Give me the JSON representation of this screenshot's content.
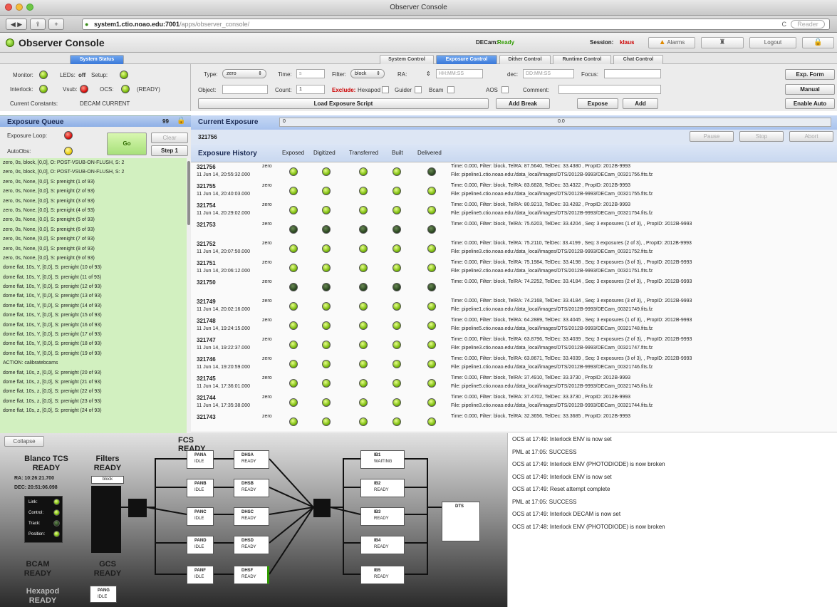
{
  "window": {
    "title": "Observer Console"
  },
  "browser": {
    "url_host": "system1.ctio.noao.edu:7001",
    "url_path": "/apps/observer_console/",
    "reader": "Reader"
  },
  "header": {
    "app_title": "Observer Console",
    "decam_label": "DECam:",
    "decam_status": "Ready",
    "session_label": "Session:",
    "session_user": "klaus",
    "alarms": "Alarms",
    "logout": "Logout"
  },
  "tabs": {
    "system_status": "System Status",
    "items": [
      "System Control",
      "Exposure Control",
      "Dither Control",
      "Runtime Control",
      "Chat Control"
    ]
  },
  "status": {
    "monitor": "Monitor:",
    "leds": "LEDs:",
    "leds_state": "off",
    "setup": "Setup:",
    "interlock": "Interlock:",
    "vsub": "Vsub:",
    "ocs": "OCS:",
    "ocs_state": "(READY)",
    "constants_label": "Current Constants:",
    "constants_value": "DECAM CURRENT"
  },
  "exposure_form": {
    "type_label": "Type:",
    "type_value": "zero",
    "time_label": "Time:",
    "time_ph": "s",
    "filter_label": "Filter:",
    "filter_value": "block",
    "ra_label": "RA:",
    "ra_ph": "HH:MM:SS",
    "dec_label": "dec:",
    "dec_ph": "DD:MM:SS",
    "focus_label": "Focus:",
    "object_label": "Object:",
    "count_label": "Count:",
    "count_value": "1",
    "exclude_label": "Exclude:",
    "hexapod": "Hexapod",
    "guider": "Guider",
    "bcam": "Bcam",
    "aos": "AOS",
    "comment_label": "Comment:",
    "load_script": "Load Exposure Script",
    "add_break": "Add Break",
    "expose": "Expose",
    "add": "Add",
    "exp_form": "Exp. Form",
    "manual": "Manual",
    "enable_auto": "Enable Auto"
  },
  "queue": {
    "title": "Exposure Queue",
    "count": "99",
    "loop_label": "Exposure Loop:",
    "autoobs_label": "AutoObs:",
    "go": "Go",
    "clear": "Clear",
    "step": "Step 1",
    "items": [
      "zero, 0s, block, [0,0], O: POST-VSUB-ON-FLUSH, S: 2",
      "zero, 0s, block, [0,0], O: POST-VSUB-ON-FLUSH, S: 2",
      "zero, 0s, None, [0,0], S: prenight (1 of 93)",
      "zero, 0s, None, [0,0], S: prenight (2 of 93)",
      "zero, 0s, None, [0,0], S: prenight (3 of 93)",
      "zero, 0s, None, [0,0], S: prenight (4 of 93)",
      "zero, 0s, None, [0,0], S: prenight (5 of 93)",
      "zero, 0s, None, [0,0], S: prenight (6 of 93)",
      "zero, 0s, None, [0,0], S: prenight (7 of 93)",
      "zero, 0s, None, [0,0], S: prenight (8 of 93)",
      "zero, 0s, None, [0,0], S: prenight (9 of 93)",
      "dome flat, 10s, Y, [0,0], S: prenight (10 of 93)",
      "dome flat, 10s, Y, [0,0], S: prenight (11 of 93)",
      "dome flat, 10s, Y, [0,0], S: prenight (12 of 93)",
      "dome flat, 10s, Y, [0,0], S: prenight (13 of 93)",
      "dome flat, 10s, Y, [0,0], S: prenight (14 of 93)",
      "dome flat, 10s, Y, [0,0], S: prenight (15 of 93)",
      "dome flat, 10s, Y, [0,0], S: prenight (16 of 93)",
      "dome flat, 10s, Y, [0,0], S: prenight (17 of 93)",
      "dome flat, 10s, Y, [0,0], S: prenight (18 of 93)",
      "dome flat, 10s, Y, [0,0], S: prenight (19 of 93)",
      "ACTION: calibratebcams",
      "dome flat, 10s, z, [0,0], S: prenight (20 of 93)",
      "dome flat, 10s, z, [0,0], S: prenight (21 of 93)",
      "dome flat, 10s, z, [0,0], S: prenight (22 of 93)",
      "dome flat, 10s, z, [0,0], S: prenight (23 of 93)",
      "dome flat, 10s, z, [0,0], S: prenight (24 of 93)"
    ]
  },
  "current": {
    "title": "Current Exposure",
    "id": "321756",
    "progress_start": "0",
    "progress_value": "0.0",
    "pause": "Pause",
    "stop": "Stop",
    "abort": "Abort"
  },
  "history": {
    "title": "Exposure History",
    "cols": [
      "Exposed",
      "Digitized",
      "Transferred",
      "Built",
      "Delivered"
    ],
    "rows": [
      {
        "id": "321756",
        "date": "11 Jun 14, 20:55:32.000",
        "type": "zero",
        "leds": "ggggd",
        "l1": "Time: 0.000, Filter: block, TelRA: 87.5640, TelDec: 33.4380 , PropID: 2012B-9993",
        "l2": "File: pipeline1.ctio.noao.edu:/data_local/images/DTS/2012B-9993/DECam_00321756.fits.fz"
      },
      {
        "id": "321755",
        "date": "11 Jun 14, 20:40:03.000",
        "type": "zero",
        "leds": "ggggg",
        "l1": "Time: 0.000, Filter: block, TelRA: 83.6828, TelDec: 33.4322 , PropID: 2012B-9993",
        "l2": "File: pipeline4.ctio.noao.edu:/data_local/images/DTS/2012B-9993/DECam_00321755.fits.fz"
      },
      {
        "id": "321754",
        "date": "11 Jun 14, 20:29:02.000",
        "type": "zero",
        "leds": "ggggg",
        "l1": "Time: 0.000, Filter: block, TelRA: 80.9213, TelDec: 33.4282 , PropID: 2012B-9993",
        "l2": "File: pipeline5.ctio.noao.edu:/data_local/images/DTS/2012B-9993/DECam_00321754.fits.fz"
      },
      {
        "id": "321753",
        "date": "",
        "type": "zero",
        "leds": "ddddd",
        "l1": "Time: 0.000, Filter: block, TelRA: 75.6203, TelDec: 33.4204 , Seq: 3 exposures (1 of 3), , PropID: 2012B-9993",
        "l2": ""
      },
      {
        "id": "321752",
        "date": "11 Jun 14, 20:07:50.000",
        "type": "zero",
        "leds": "ggggg",
        "l1": "Time: 0.000, Filter: block, TelRA: 75.2110, TelDec: 33.4199 , Seq: 3 exposures (2 of 3), , PropID: 2012B-9993",
        "l2": "File: pipeline3.ctio.noao.edu:/data_local/images/DTS/2012B-9993/DECam_00321752.fits.fz"
      },
      {
        "id": "321751",
        "date": "11 Jun 14, 20:06:12.000",
        "type": "zero",
        "leds": "ggggg",
        "l1": "Time: 0.000, Filter: block, TelRA: 75.1984, TelDec: 33.4198 , Seq: 3 exposures (3 of 3), , PropID: 2012B-9993",
        "l2": "File: pipeline2.ctio.noao.edu:/data_local/images/DTS/2012B-9993/DECam_00321751.fits.fz"
      },
      {
        "id": "321750",
        "date": "",
        "type": "zero",
        "leds": "ddddd",
        "l1": "Time: 0.000, Filter: block, TelRA: 74.2252, TelDec: 33.4184 , Seq: 3 exposures (2 of 3), , PropID: 2012B-9993",
        "l2": ""
      },
      {
        "id": "321749",
        "date": "11 Jun 14, 20:02:16.000",
        "type": "zero",
        "leds": "ggggg",
        "l1": "Time: 0.000, Filter: block, TelRA: 74.2168, TelDec: 33.4184 , Seq: 3 exposures (3 of 3), , PropID: 2012B-9993",
        "l2": "File: pipeline1.ctio.noao.edu:/data_local/images/DTS/2012B-9993/DECam_00321749.fits.fz"
      },
      {
        "id": "321748",
        "date": "11 Jun 14, 19:24:15.000",
        "type": "zero",
        "leds": "ggggg",
        "l1": "Time: 0.000, Filter: block, TelRA: 64.2889, TelDec: 33.4045 , Seq: 3 exposures (1 of 3), , PropID: 2012B-9993",
        "l2": "File: pipeline5.ctio.noao.edu:/data_local/images/DTS/2012B-9993/DECam_00321748.fits.fz"
      },
      {
        "id": "321747",
        "date": "11 Jun 14, 19:22:37.000",
        "type": "zero",
        "leds": "ggggg",
        "l1": "Time: 0.000, Filter: block, TelRA: 63.8796, TelDec: 33.4039 , Seq: 3 exposures (2 of 3), , PropID: 2012B-9993",
        "l2": "File: pipeline3.ctio.noao.edu:/data_local/images/DTS/2012B-9993/DECam_00321747.fits.fz"
      },
      {
        "id": "321746",
        "date": "11 Jun 14, 19:20:59.000",
        "type": "zero",
        "leds": "ggggg",
        "l1": "Time: 0.000, Filter: block, TelRA: 63.8671, TelDec: 33.4039 , Seq: 3 exposures (3 of 3), , PropID: 2012B-9993",
        "l2": "File: pipeline1.ctio.noao.edu:/data_local/images/DTS/2012B-9993/DECam_00321746.fits.fz"
      },
      {
        "id": "321745",
        "date": "11 Jun 14, 17:36:01.000",
        "type": "zero",
        "leds": "ggggg",
        "l1": "Time: 0.000, Filter: block, TelRA: 37.4910, TelDec: 33.3730 , PropID: 2012B-9993",
        "l2": "File: pipeline5.ctio.noao.edu:/data_local/images/DTS/2012B-9993/DECam_00321745.fits.fz"
      },
      {
        "id": "321744",
        "date": "11 Jun 14, 17:35:38.000",
        "type": "zero",
        "leds": "ggggg",
        "l1": "Time: 0.000, Filter: block, TelRA: 37.4702, TelDec: 33.3730 , PropID: 2012B-9993",
        "l2": "File: pipeline3.ctio.noao.edu:/data_local/images/DTS/2012B-9993/DECam_00321744.fits.fz"
      },
      {
        "id": "321743",
        "date": "",
        "type": "zero",
        "leds": "ggggg",
        "l1": "Time: 0.000, Filter: block, TelRA: 32.3656, TelDec: 33.3685 , PropID: 2012B-9993",
        "l2": ""
      }
    ]
  },
  "diagram": {
    "collapse": "Collapse",
    "blanco": "Blanco TCS",
    "blanco_state": "READY",
    "ra": "RA: 10:26:21.700",
    "dec": "DEC: 20:51:06.098",
    "filters": "Filters",
    "filters_state": "READY",
    "filter_value": "block",
    "fcs": "FCS",
    "fcs_state": "READY",
    "link": "Link:",
    "control": "Control:",
    "track": "Track:",
    "position": "Position:",
    "bcam": "BCAM",
    "bcam_state": "READY",
    "gcs": "GCS",
    "gcs_state": "READY",
    "hexapod": "Hexapod",
    "hexapod_state": "READY",
    "dts": "DTS",
    "pans": [
      {
        "name": "PANA",
        "state": "IDLE"
      },
      {
        "name": "PANB",
        "state": "IDLE"
      },
      {
        "name": "PANC",
        "state": "IDLE"
      },
      {
        "name": "PAND",
        "state": "IDLE"
      },
      {
        "name": "PANF",
        "state": "IDLE"
      }
    ],
    "pang": {
      "name": "PANG",
      "state": "IDLE"
    },
    "dhs": [
      {
        "name": "DHSA",
        "state": "READY"
      },
      {
        "name": "DHSB",
        "state": "READY"
      },
      {
        "name": "DHSC",
        "state": "READY"
      },
      {
        "name": "DHSD",
        "state": "READY"
      },
      {
        "name": "DHSF",
        "state": "READY"
      }
    ],
    "ibs": [
      {
        "name": "IB1",
        "state": "WAITING"
      },
      {
        "name": "IB2",
        "state": "READY"
      },
      {
        "name": "IB3",
        "state": "READY"
      },
      {
        "name": "IB4",
        "state": "READY"
      },
      {
        "name": "IB5",
        "state": "READY"
      }
    ]
  },
  "log": [
    "OCS at 17:49: Interlock ENV is now set",
    "PML at 17:05: SUCCESS",
    "OCS at 17:49: Interlock ENV (PHOTODIODE) is now broken",
    "OCS at 17:49: Interlock ENV is now set",
    "OCS at 17:49: Reset attempt complete",
    "PML at 17:05: SUCCESS",
    "OCS at 17:49: Interlock DECAM is now set",
    "OCS at 17:48: Interlock ENV (PHOTODIODE) is now broken"
  ],
  "colors": {
    "accent": "#3a78d8",
    "ready_green": "#2f9a00",
    "alarm_red": "#cc0000",
    "queue_bg": "#d2f0c0"
  }
}
